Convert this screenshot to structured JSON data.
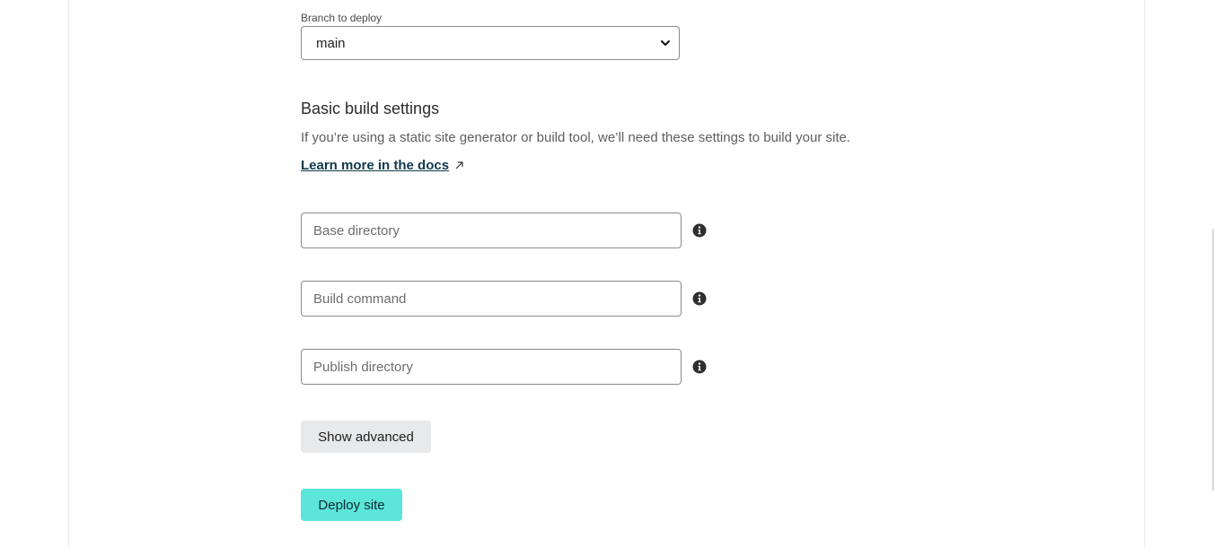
{
  "branch": {
    "label": "Branch to deploy",
    "selected": "main"
  },
  "build_settings": {
    "title": "Basic build settings",
    "description": "If you’re using a static site generator or build tool, we’ll need these settings to build your site.",
    "docs_link": "Learn more in the docs",
    "fields": {
      "base_directory": {
        "value": "",
        "placeholder": "Base directory"
      },
      "build_command": {
        "value": "",
        "placeholder": "Build command"
      },
      "publish_directory": {
        "value": "",
        "placeholder": "Publish directory"
      }
    }
  },
  "actions": {
    "show_advanced": "Show advanced",
    "deploy": "Deploy site"
  },
  "icons": {
    "info": "info-icon",
    "external": "external-link-icon",
    "chevron": "chevron-down-icon"
  },
  "colors": {
    "deploy_button": "#5ce5d9",
    "advanced_button": "#e8e9ea",
    "link": "#0f3a4a"
  }
}
